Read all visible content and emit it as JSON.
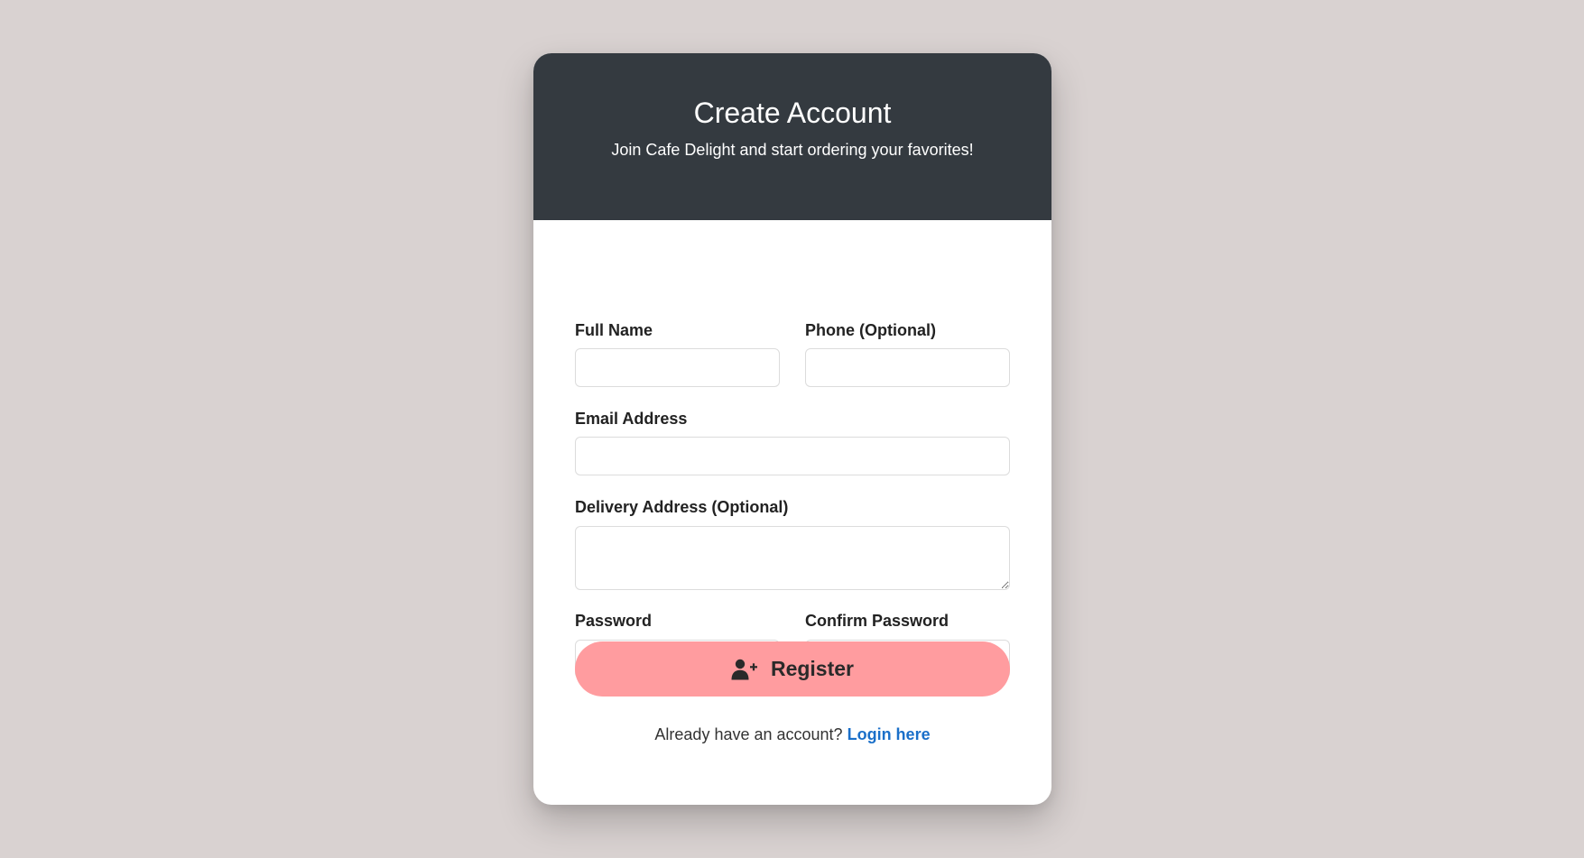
{
  "header": {
    "title": "Create Account",
    "subtitle": "Join Cafe Delight and start ordering your favorites!",
    "background_color": "#343a40"
  },
  "form": {
    "full_name": {
      "label": "Full Name",
      "value": "",
      "placeholder": ""
    },
    "phone": {
      "label": "Phone (Optional)",
      "value": "",
      "placeholder": ""
    },
    "email": {
      "label": "Email Address",
      "value": "",
      "placeholder": ""
    },
    "delivery_address": {
      "label": "Delivery Address (Optional)",
      "value": "",
      "placeholder": ""
    },
    "password": {
      "label": "Password",
      "value": "",
      "placeholder": ""
    },
    "confirm_password": {
      "label": "Confirm Password",
      "value": "",
      "placeholder": ""
    }
  },
  "register_button": {
    "label": "Register",
    "icon": "user-plus-icon",
    "color": "#ff9c9f"
  },
  "footer": {
    "prompt": "Already have an account?",
    "link_label": "Login here",
    "link_color": "#1a6fc9"
  }
}
